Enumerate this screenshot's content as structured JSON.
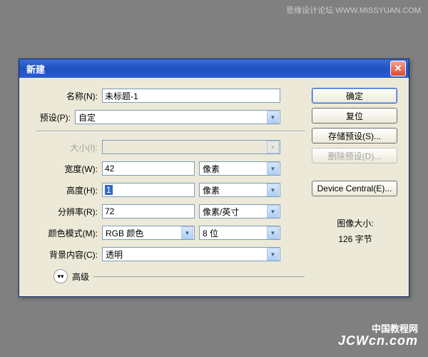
{
  "watermark": {
    "top": "思缘设计论坛  WWW.MISSYUAN.COM",
    "bottom_cn": "中国教程网",
    "bottom_en": "JCWcn.com"
  },
  "dialog": {
    "title": "新建",
    "labels": {
      "name": "名称(N):",
      "preset": "预设(P):",
      "size": "大小(I):",
      "width": "宽度(W):",
      "height": "高度(H):",
      "resolution": "分辨率(R):",
      "colormode": "颜色模式(M):",
      "bgcontent": "背景内容(C):",
      "advanced": "高级"
    },
    "values": {
      "name": "未标题-1",
      "preset": "自定",
      "size": "",
      "width": "42",
      "width_unit": "像素",
      "height": "1",
      "height_unit": "像素",
      "resolution": "72",
      "resolution_unit": "像素/英寸",
      "colormode": "RGB 颜色",
      "colordepth": "8 位",
      "bgcontent": "透明"
    },
    "buttons": {
      "ok": "确定",
      "reset": "复位",
      "save_preset": "存储预设(S)...",
      "delete_preset": "删除预设(D)...",
      "device_central": "Device Central(E)..."
    },
    "image_size": {
      "label": "图像大小:",
      "value": "126 字节"
    }
  }
}
